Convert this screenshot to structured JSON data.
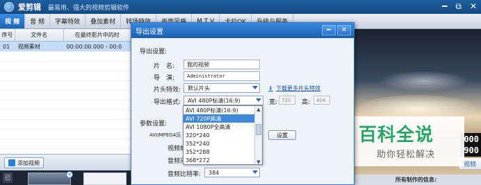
{
  "window": {
    "app_title": "爱剪辑",
    "subtitle": "最易用、强大的视频剪辑软件",
    "controls": [
      "━",
      "⧉",
      "✕"
    ]
  },
  "tabs": [
    {
      "label": "视 频",
      "active": true
    },
    {
      "label": "音 频",
      "active": false
    },
    {
      "label": "字幕特效",
      "active": false
    },
    {
      "label": "叠加素材",
      "active": false
    },
    {
      "label": "转场特效",
      "active": false
    },
    {
      "label": "画面风格",
      "active": false
    },
    {
      "label": "M T V",
      "active": false
    },
    {
      "label": "卡拉OK",
      "active": false
    },
    {
      "label": "升级与服务",
      "active": false
    }
  ],
  "clip_list": {
    "headers": [
      "序号",
      "文件名",
      "在最终影片中的时"
    ],
    "rows": [
      {
        "index": "01",
        "name": "视频素材",
        "time": "00:00:00.000 - 00:0"
      }
    ]
  },
  "add_video_label": "添加视频",
  "timeline": {
    "track_label": "已",
    "close_glyph": "✕"
  },
  "preview": {
    "digits": [
      "000",
      "900"
    ],
    "video_button": "视频",
    "info_label": "所有制作的信息:"
  },
  "dialog": {
    "title": "导出设置",
    "buttons": [
      "━",
      "✕"
    ],
    "export_section": "导出设置:",
    "name_label": "片　名:",
    "name_value": "我的视频",
    "director_label": "导　演:",
    "director_value": "Administrator",
    "intro_label": "片头特效:",
    "intro_value": "默认片头",
    "download_link": "下载更多片头特效",
    "format_label": "导出格式:",
    "format_value": "AVI 480P标清(16:9)",
    "width_label": "宽:",
    "width_value": "720",
    "height_label": "高:",
    "height_value": "404",
    "params_section": "参数设置:",
    "codec_label": "AVI/MPEG4压",
    "settings_button": "设置",
    "video_rate_label": "视频帧",
    "audio_sample_label": "音频采",
    "audio_bit_label": "音频比特率:",
    "audio_bit_value": "384"
  },
  "format_options": [
    {
      "label": "AVI 480P标清(16:9)",
      "selected": false
    },
    {
      "label": "AVI 720P高清",
      "selected": true
    },
    {
      "label": "AVI 1080P全高清",
      "selected": false
    },
    {
      "label": "320*240",
      "selected": false
    },
    {
      "label": "352*240",
      "selected": false
    },
    {
      "label": "352*288",
      "selected": false
    },
    {
      "label": "368*272",
      "selected": false
    }
  ],
  "watermark": {
    "main": "百科全说",
    "sub": "助你轻松解决"
  }
}
